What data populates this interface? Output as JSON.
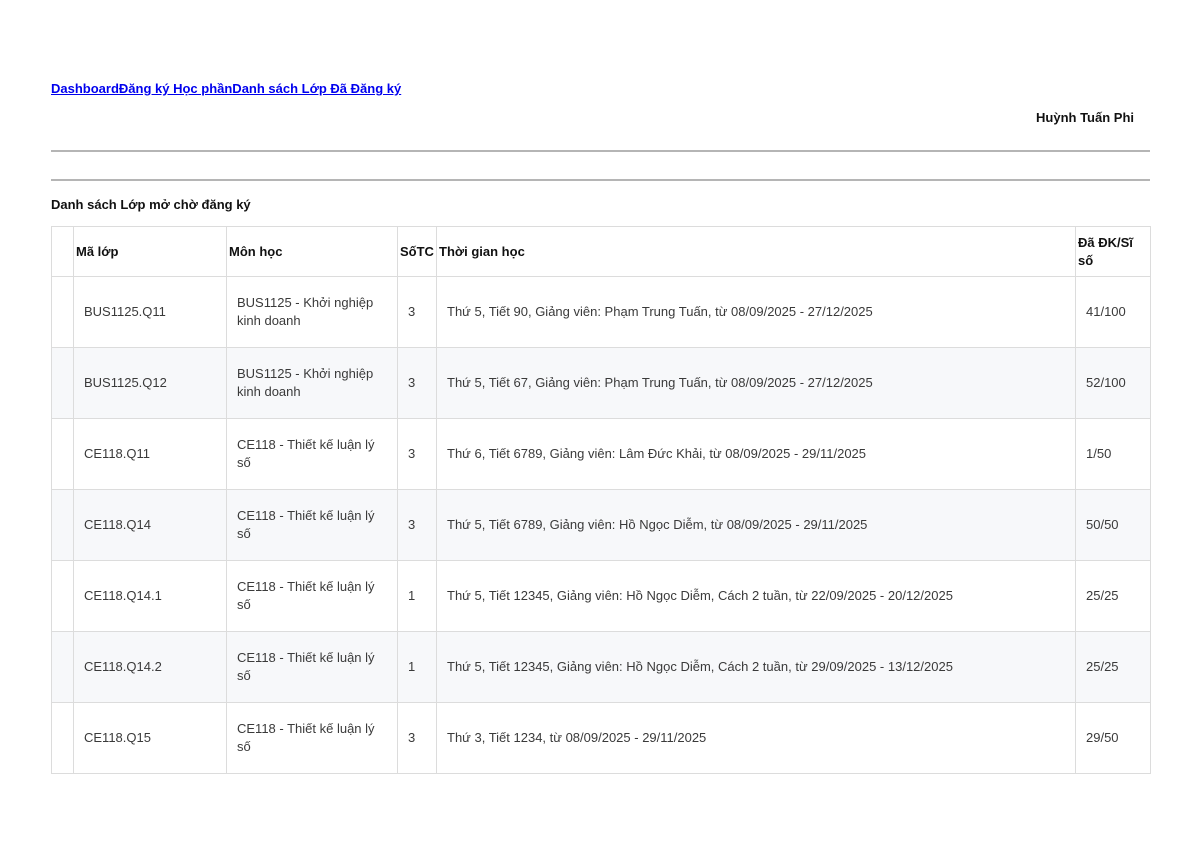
{
  "nav": {
    "breadcrumb": "DashboardĐăng ký Học phầnDanh sách Lớp Đã Đăng ký"
  },
  "user": {
    "name": "Huỳnh Tuấn Phi"
  },
  "section": {
    "title": "Danh sách Lớp mở chờ đăng ký"
  },
  "table": {
    "headers": {
      "code": "Mã lớp",
      "subject": "Môn học",
      "credits": "SốTC",
      "schedule": "Thời gian học",
      "count": "Đã ĐK/Sĩ số"
    },
    "rows": [
      {
        "code": "BUS1125.Q11",
        "subject": "BUS1125 - Khởi nghiệp kinh doanh",
        "credits": "3",
        "schedule": "Thứ 5, Tiết 90, Giảng viên: Phạm Trung Tuấn, từ 08/09/2025 - 27/12/2025",
        "count": "41/100"
      },
      {
        "code": "BUS1125.Q12",
        "subject": "BUS1125 - Khởi nghiệp kinh doanh",
        "credits": "3",
        "schedule": "Thứ 5, Tiết 67, Giảng viên: Phạm Trung Tuấn, từ 08/09/2025 - 27/12/2025",
        "count": "52/100"
      },
      {
        "code": "CE118.Q11",
        "subject": "CE118 - Thiết kế luận lý số",
        "credits": "3",
        "schedule": "Thứ 6, Tiết 6789, Giảng viên: Lâm Đức Khải, từ 08/09/2025 - 29/11/2025",
        "count": "1/50"
      },
      {
        "code": "CE118.Q14",
        "subject": "CE118 - Thiết kế luận lý số",
        "credits": "3",
        "schedule": "Thứ 5, Tiết 6789, Giảng viên: Hồ Ngọc Diễm, từ 08/09/2025 - 29/11/2025",
        "count": "50/50"
      },
      {
        "code": "CE118.Q14.1",
        "subject": "CE118 - Thiết kế luận lý số",
        "credits": "1",
        "schedule": "Thứ 5, Tiết 12345, Giảng viên: Hồ Ngọc Diễm, Cách 2 tuần, từ 22/09/2025 - 20/12/2025",
        "count": "25/25"
      },
      {
        "code": "CE118.Q14.2",
        "subject": "CE118 - Thiết kế luận lý số",
        "credits": "1",
        "schedule": "Thứ 5, Tiết 12345, Giảng viên: Hồ Ngọc Diễm, Cách 2 tuần, từ 29/09/2025 - 13/12/2025",
        "count": "25/25"
      },
      {
        "code": "CE118.Q15",
        "subject": "CE118 - Thiết kế luận lý số",
        "credits": "3",
        "schedule": "Thứ 3, Tiết 1234, từ 08/09/2025 - 29/11/2025",
        "count": "29/50"
      }
    ]
  }
}
